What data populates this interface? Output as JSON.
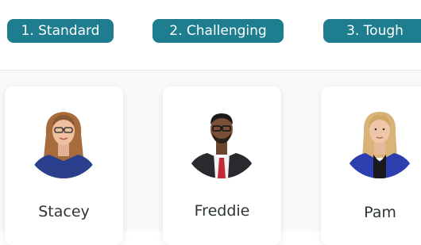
{
  "tabs": [
    {
      "label": "1. Standard"
    },
    {
      "label": "2. Challenging"
    },
    {
      "label": "3. Tough"
    }
  ],
  "personas": [
    {
      "name": "Stacey"
    },
    {
      "name": "Freddie"
    },
    {
      "name": "Pam"
    }
  ],
  "colors": {
    "accent": "#1e7d8e",
    "pill_text": "#ffffff",
    "card_background": "#ffffff",
    "page_background": "#f7f9fb",
    "name_text": "#2d3438"
  }
}
